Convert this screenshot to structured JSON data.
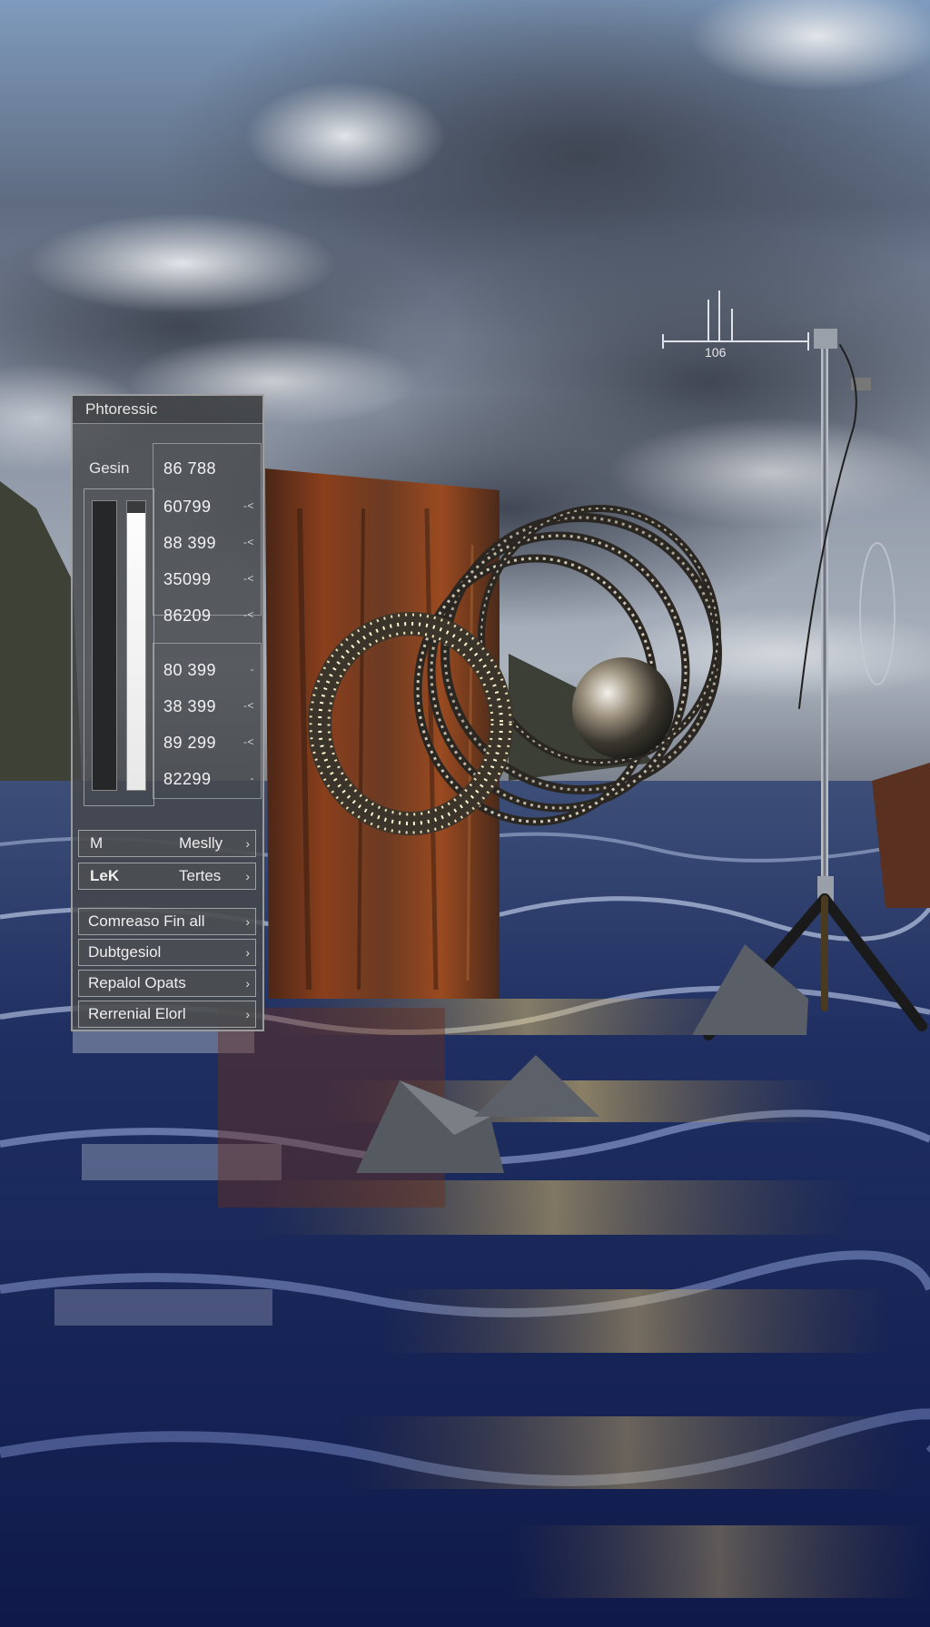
{
  "scene": {
    "description_icons": [
      "clouds",
      "rusted-wooden-board",
      "metal-coils",
      "chrome-sphere",
      "light-stand",
      "rocks",
      "water"
    ]
  },
  "panel": {
    "title": "Phtoressic",
    "row_label": "Gesin",
    "readouts": [
      "86 788",
      "60799",
      "88 399",
      "35099",
      "86209",
      "80 399",
      "38 399",
      "89 299",
      "82299"
    ],
    "meter_level": 0.96,
    "dropdowns": {
      "top_left": "M",
      "top_right": "Meslly",
      "second_left": "LeK",
      "second_right": "Tertes",
      "items": [
        "Comreaso Fin all",
        "Dubtgesiol",
        "Repalol Opats",
        "Rerrenial Elorl"
      ]
    }
  },
  "scale_marker": {
    "label": "106"
  }
}
